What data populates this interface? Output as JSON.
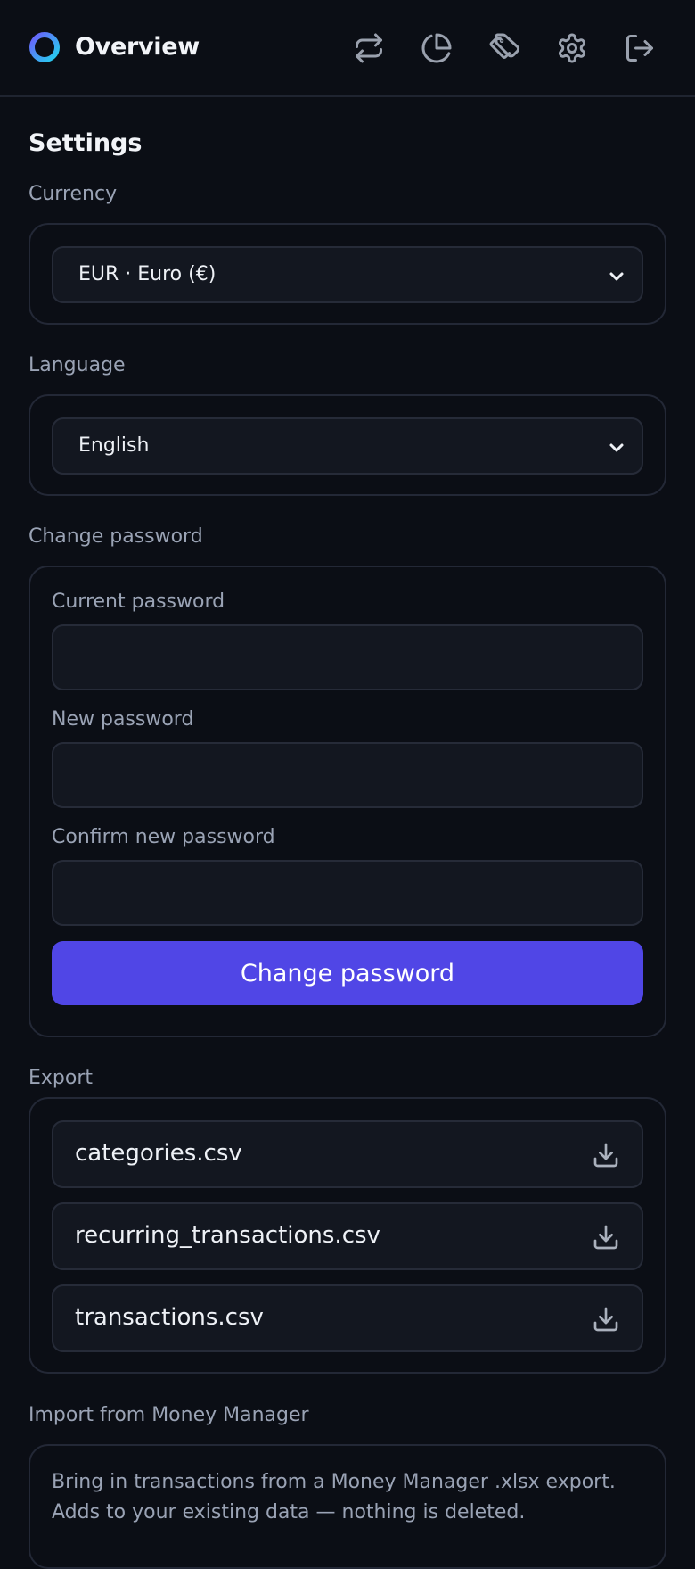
{
  "header": {
    "title": "Overview",
    "nav_icons": [
      "transactions-icon",
      "pie-chart-icon",
      "tag-icon",
      "gear-icon",
      "logout-icon"
    ],
    "accent": "#5046e6"
  },
  "settings": {
    "title": "Settings",
    "currency": {
      "label": "Currency",
      "value": "EUR · Euro (€)"
    },
    "language": {
      "label": "Language",
      "value": "English"
    },
    "change_password": {
      "label": "Change password",
      "current_label": "Current password",
      "new_label": "New password",
      "confirm_label": "Confirm new password",
      "current_value": "",
      "new_value": "",
      "confirm_value": "",
      "button_label": "Change password"
    },
    "export": {
      "label": "Export",
      "files": [
        "categories.csv",
        "recurring_transactions.csv",
        "transactions.csv"
      ]
    },
    "import": {
      "label": "Import from Money Manager",
      "description": "Bring in transactions from a Money Manager .xlsx export. Adds to your existing data — nothing is deleted."
    }
  }
}
